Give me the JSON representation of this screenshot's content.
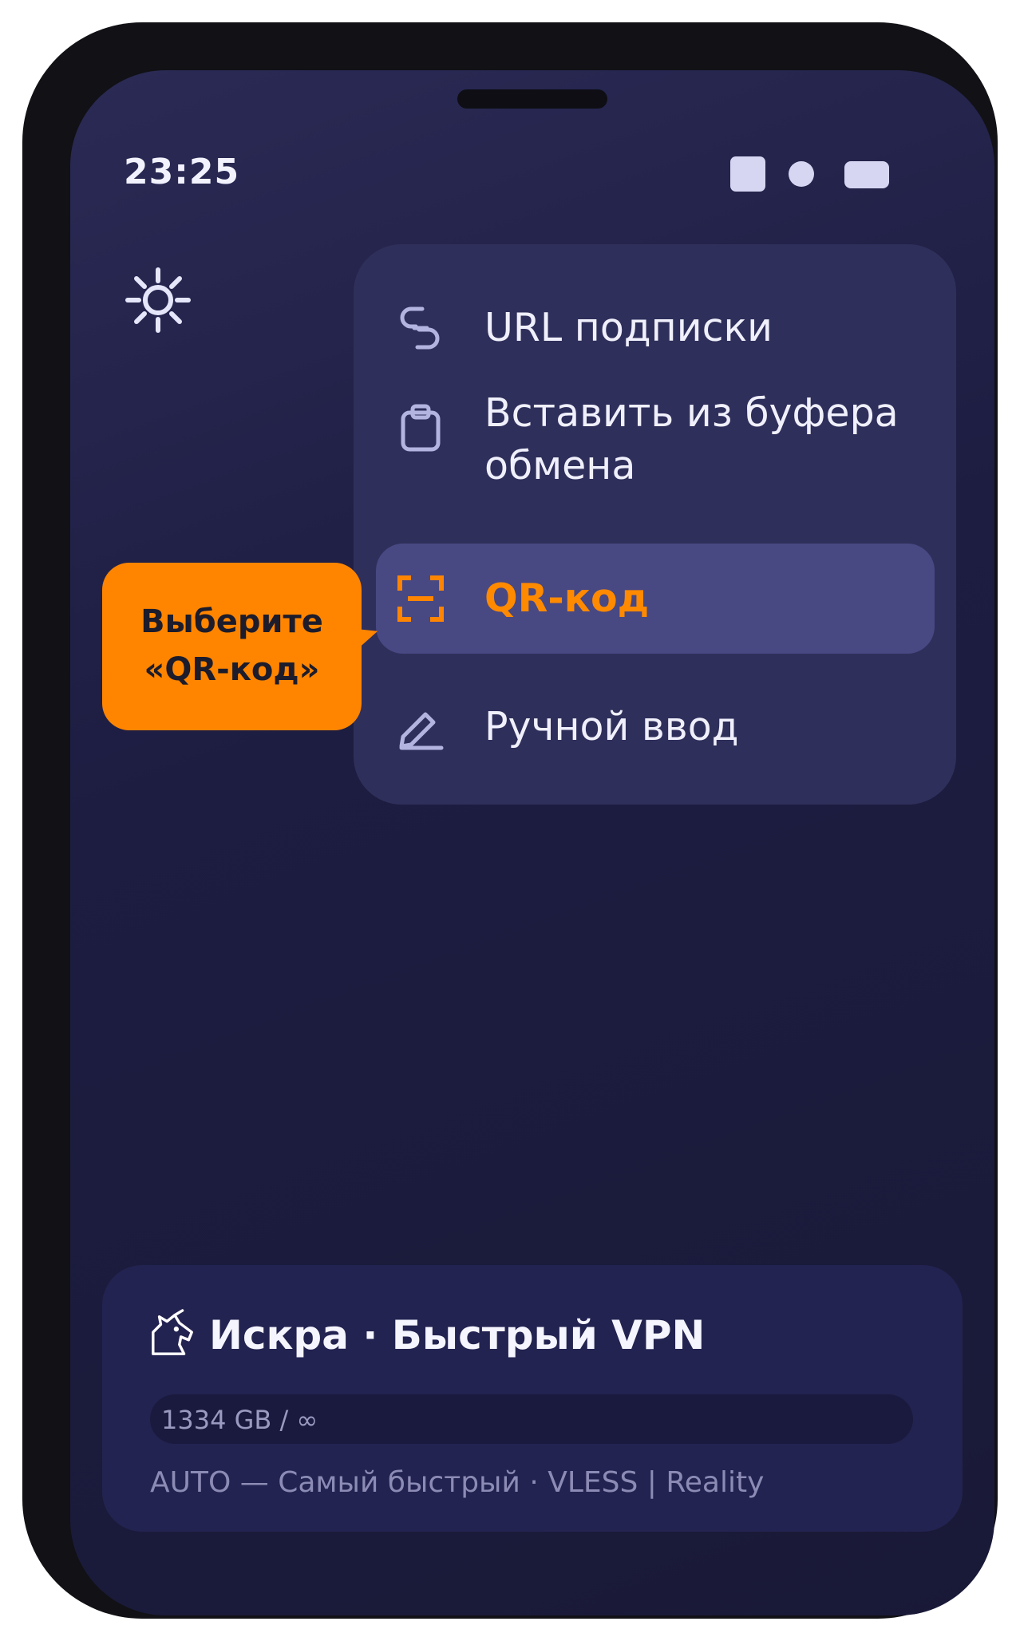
{
  "status_bar": {
    "time": "23:25"
  },
  "menu": {
    "items": [
      {
        "label": "URL подписки",
        "icon": "subscription-link-icon"
      },
      {
        "label": "Вставить из буфера обмена",
        "icon": "clipboard-icon"
      },
      {
        "label": "QR-код",
        "icon": "qr-scan-icon",
        "highlighted": true
      },
      {
        "label": "Ручной ввод",
        "icon": "pencil-icon"
      }
    ]
  },
  "callout": {
    "line1": "Выберите",
    "line2": "«QR-код»"
  },
  "server_card": {
    "name": "Искра · Быстрый VPN",
    "icon": "unicorn-icon",
    "traffic": "1334 GB / ∞",
    "protocol": "AUTO — Самый быстрый · VLESS | Reality"
  },
  "colors": {
    "accent": "#ff8500",
    "menu_bg": "#2f2f5b",
    "menu_highlight": "#484883",
    "screen_bg": "#1d1d42"
  }
}
